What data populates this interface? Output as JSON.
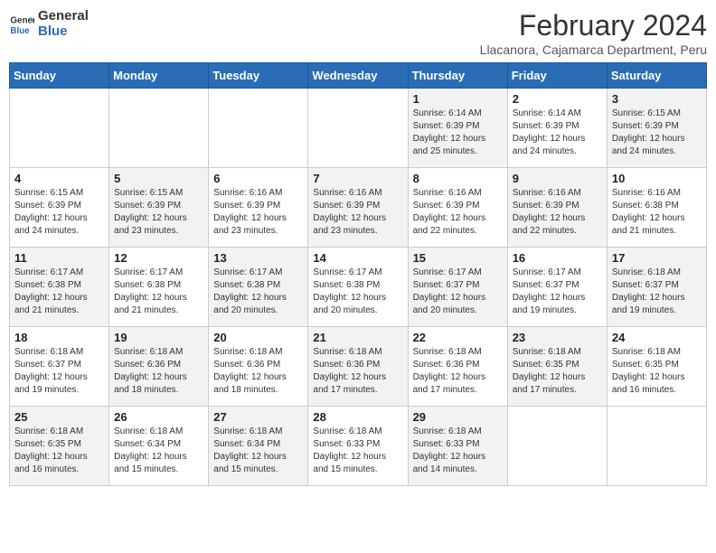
{
  "logo": {
    "line1": "General",
    "line2": "Blue"
  },
  "title": "February 2024",
  "subtitle": "Llacanora, Cajamarca Department, Peru",
  "days_of_week": [
    "Sunday",
    "Monday",
    "Tuesday",
    "Wednesday",
    "Thursday",
    "Friday",
    "Saturday"
  ],
  "weeks": [
    [
      {
        "day": "",
        "info": ""
      },
      {
        "day": "",
        "info": ""
      },
      {
        "day": "",
        "info": ""
      },
      {
        "day": "",
        "info": ""
      },
      {
        "day": "1",
        "info": "Sunrise: 6:14 AM\nSunset: 6:39 PM\nDaylight: 12 hours and 25 minutes."
      },
      {
        "day": "2",
        "info": "Sunrise: 6:14 AM\nSunset: 6:39 PM\nDaylight: 12 hours and 24 minutes."
      },
      {
        "day": "3",
        "info": "Sunrise: 6:15 AM\nSunset: 6:39 PM\nDaylight: 12 hours and 24 minutes."
      }
    ],
    [
      {
        "day": "4",
        "info": "Sunrise: 6:15 AM\nSunset: 6:39 PM\nDaylight: 12 hours and 24 minutes."
      },
      {
        "day": "5",
        "info": "Sunrise: 6:15 AM\nSunset: 6:39 PM\nDaylight: 12 hours and 23 minutes."
      },
      {
        "day": "6",
        "info": "Sunrise: 6:16 AM\nSunset: 6:39 PM\nDaylight: 12 hours and 23 minutes."
      },
      {
        "day": "7",
        "info": "Sunrise: 6:16 AM\nSunset: 6:39 PM\nDaylight: 12 hours and 23 minutes."
      },
      {
        "day": "8",
        "info": "Sunrise: 6:16 AM\nSunset: 6:39 PM\nDaylight: 12 hours and 22 minutes."
      },
      {
        "day": "9",
        "info": "Sunrise: 6:16 AM\nSunset: 6:39 PM\nDaylight: 12 hours and 22 minutes."
      },
      {
        "day": "10",
        "info": "Sunrise: 6:16 AM\nSunset: 6:38 PM\nDaylight: 12 hours and 21 minutes."
      }
    ],
    [
      {
        "day": "11",
        "info": "Sunrise: 6:17 AM\nSunset: 6:38 PM\nDaylight: 12 hours and 21 minutes."
      },
      {
        "day": "12",
        "info": "Sunrise: 6:17 AM\nSunset: 6:38 PM\nDaylight: 12 hours and 21 minutes."
      },
      {
        "day": "13",
        "info": "Sunrise: 6:17 AM\nSunset: 6:38 PM\nDaylight: 12 hours and 20 minutes."
      },
      {
        "day": "14",
        "info": "Sunrise: 6:17 AM\nSunset: 6:38 PM\nDaylight: 12 hours and 20 minutes."
      },
      {
        "day": "15",
        "info": "Sunrise: 6:17 AM\nSunset: 6:37 PM\nDaylight: 12 hours and 20 minutes."
      },
      {
        "day": "16",
        "info": "Sunrise: 6:17 AM\nSunset: 6:37 PM\nDaylight: 12 hours and 19 minutes."
      },
      {
        "day": "17",
        "info": "Sunrise: 6:18 AM\nSunset: 6:37 PM\nDaylight: 12 hours and 19 minutes."
      }
    ],
    [
      {
        "day": "18",
        "info": "Sunrise: 6:18 AM\nSunset: 6:37 PM\nDaylight: 12 hours and 19 minutes."
      },
      {
        "day": "19",
        "info": "Sunrise: 6:18 AM\nSunset: 6:36 PM\nDaylight: 12 hours and 18 minutes."
      },
      {
        "day": "20",
        "info": "Sunrise: 6:18 AM\nSunset: 6:36 PM\nDaylight: 12 hours and 18 minutes."
      },
      {
        "day": "21",
        "info": "Sunrise: 6:18 AM\nSunset: 6:36 PM\nDaylight: 12 hours and 17 minutes."
      },
      {
        "day": "22",
        "info": "Sunrise: 6:18 AM\nSunset: 6:36 PM\nDaylight: 12 hours and 17 minutes."
      },
      {
        "day": "23",
        "info": "Sunrise: 6:18 AM\nSunset: 6:35 PM\nDaylight: 12 hours and 17 minutes."
      },
      {
        "day": "24",
        "info": "Sunrise: 6:18 AM\nSunset: 6:35 PM\nDaylight: 12 hours and 16 minutes."
      }
    ],
    [
      {
        "day": "25",
        "info": "Sunrise: 6:18 AM\nSunset: 6:35 PM\nDaylight: 12 hours and 16 minutes."
      },
      {
        "day": "26",
        "info": "Sunrise: 6:18 AM\nSunset: 6:34 PM\nDaylight: 12 hours and 15 minutes."
      },
      {
        "day": "27",
        "info": "Sunrise: 6:18 AM\nSunset: 6:34 PM\nDaylight: 12 hours and 15 minutes."
      },
      {
        "day": "28",
        "info": "Sunrise: 6:18 AM\nSunset: 6:33 PM\nDaylight: 12 hours and 15 minutes."
      },
      {
        "day": "29",
        "info": "Sunrise: 6:18 AM\nSunset: 6:33 PM\nDaylight: 12 hours and 14 minutes."
      },
      {
        "day": "",
        "info": ""
      },
      {
        "day": "",
        "info": ""
      }
    ]
  ]
}
